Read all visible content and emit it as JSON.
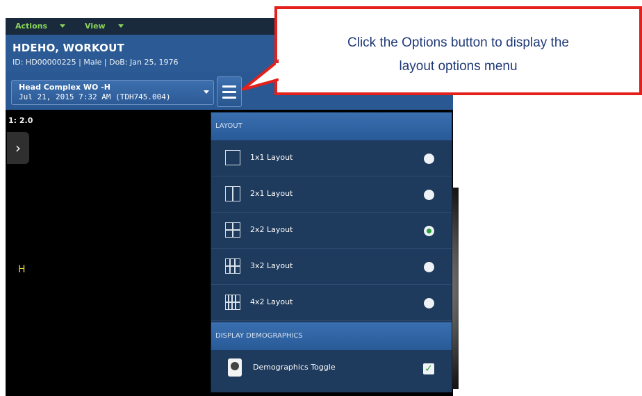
{
  "menubar": {
    "actions": "Actions",
    "view": "View"
  },
  "patient": {
    "name": "HDEHO, WORKOUT",
    "info": "ID: HD00000225 | Male | DoB: Jan 25, 1976"
  },
  "study": {
    "name": "Head Complex WO -H",
    "date": "Jul 21, 2015 7:32 AM (TDH745.004)"
  },
  "viewer": {
    "zoom": "1: 2.0",
    "orientation": "H"
  },
  "menu": {
    "layout_header": "LAYOUT",
    "layouts": [
      {
        "label": "1x1 Layout",
        "cols": 1,
        "rows": 1,
        "selected": false
      },
      {
        "label": "2x1 Layout",
        "cols": 2,
        "rows": 1,
        "selected": false
      },
      {
        "label": "2x2 Layout",
        "cols": 2,
        "rows": 2,
        "selected": true
      },
      {
        "label": "3x2 Layout",
        "cols": 3,
        "rows": 2,
        "selected": false
      },
      {
        "label": "4x2 Layout",
        "cols": 4,
        "rows": 2,
        "selected": false
      }
    ],
    "demographics_header": "DISPLAY DEMOGRAPHICS",
    "demographics_toggle": {
      "label": "Demographics Toggle",
      "checked": true
    }
  },
  "callout": {
    "line1": "Click the Options button to display the",
    "line2": "layout options menu"
  },
  "colors": {
    "callout_border": "#e3201c",
    "header_blue": "#2b5a94",
    "menu_green": "#8bd35a",
    "selected_green": "#2e9c3f"
  }
}
